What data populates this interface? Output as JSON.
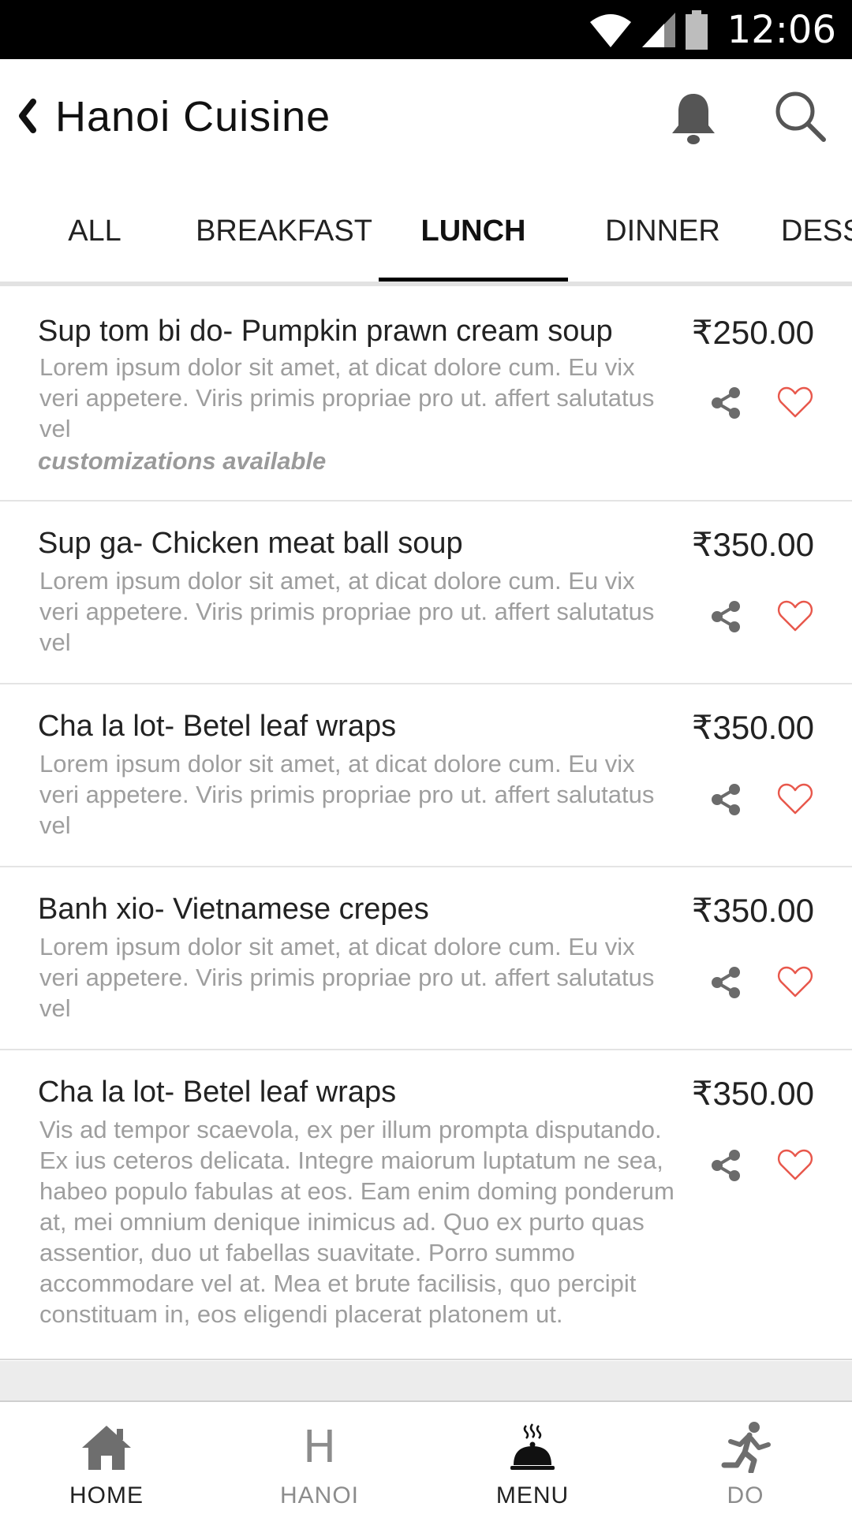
{
  "status_bar": {
    "time": "12:06"
  },
  "header": {
    "title": "Hanoi Cuisine"
  },
  "tabs": [
    {
      "label": "ALL"
    },
    {
      "label": "BREAKFAST"
    },
    {
      "label": "LUNCH"
    },
    {
      "label": "DINNER"
    },
    {
      "label": "DESS"
    }
  ],
  "active_tab": "LUNCH",
  "menu_items": [
    {
      "name": "Sup tom bi do- Pumpkin prawn cream soup",
      "price": "₹250.00",
      "description": "Lorem ipsum dolor sit amet, at dicat dolore cum. Eu vix veri appetere. Viris primis propriae pro ut. affert salutatus vel",
      "note": "customizations available"
    },
    {
      "name": "Sup ga- Chicken meat ball soup",
      "price": "₹350.00",
      "description": "Lorem ipsum dolor sit amet, at dicat dolore cum. Eu vix veri appetere. Viris primis propriae pro ut. affert salutatus vel"
    },
    {
      "name": "Cha la lot- Betel leaf wraps",
      "price": "₹350.00",
      "description": "Lorem ipsum dolor sit amet, at dicat dolore cum. Eu vix veri appetere. Viris primis propriae pro ut. affert salutatus vel"
    },
    {
      "name": "Banh xio- Vietnamese crepes",
      "price": "₹350.00",
      "description": "Lorem ipsum dolor sit amet, at dicat dolore cum. Eu vix veri appetere. Viris primis propriae pro ut. affert salutatus vel"
    },
    {
      "name": "Cha la lot- Betel leaf wraps",
      "price": "₹350.00",
      "description": "Vis ad tempor scaevola, ex per illum prompta disputando. Ex ius ceteros delicata. Integre maiorum luptatum ne sea, habeo populo fabulas at eos. Eam enim doming ponderum at, mei omnium denique inimicus ad. Quo ex purto quas assentior, duo ut fabellas suavitate. Porro summo accommodare vel at. Mea et brute facilisis, quo percipit constituam in, eos eligendi placerat platonem ut."
    }
  ],
  "bottom_nav": [
    {
      "label": "HOME",
      "icon": "home-icon"
    },
    {
      "label": "HANOI",
      "icon": "H"
    },
    {
      "label": "MENU",
      "icon": "cloche-icon"
    },
    {
      "label": "DO",
      "icon": "running-person-icon"
    }
  ],
  "colors": {
    "heart": "#e8584c",
    "divider": "#e4e4e4",
    "text_secondary": "#9e9e9e"
  }
}
